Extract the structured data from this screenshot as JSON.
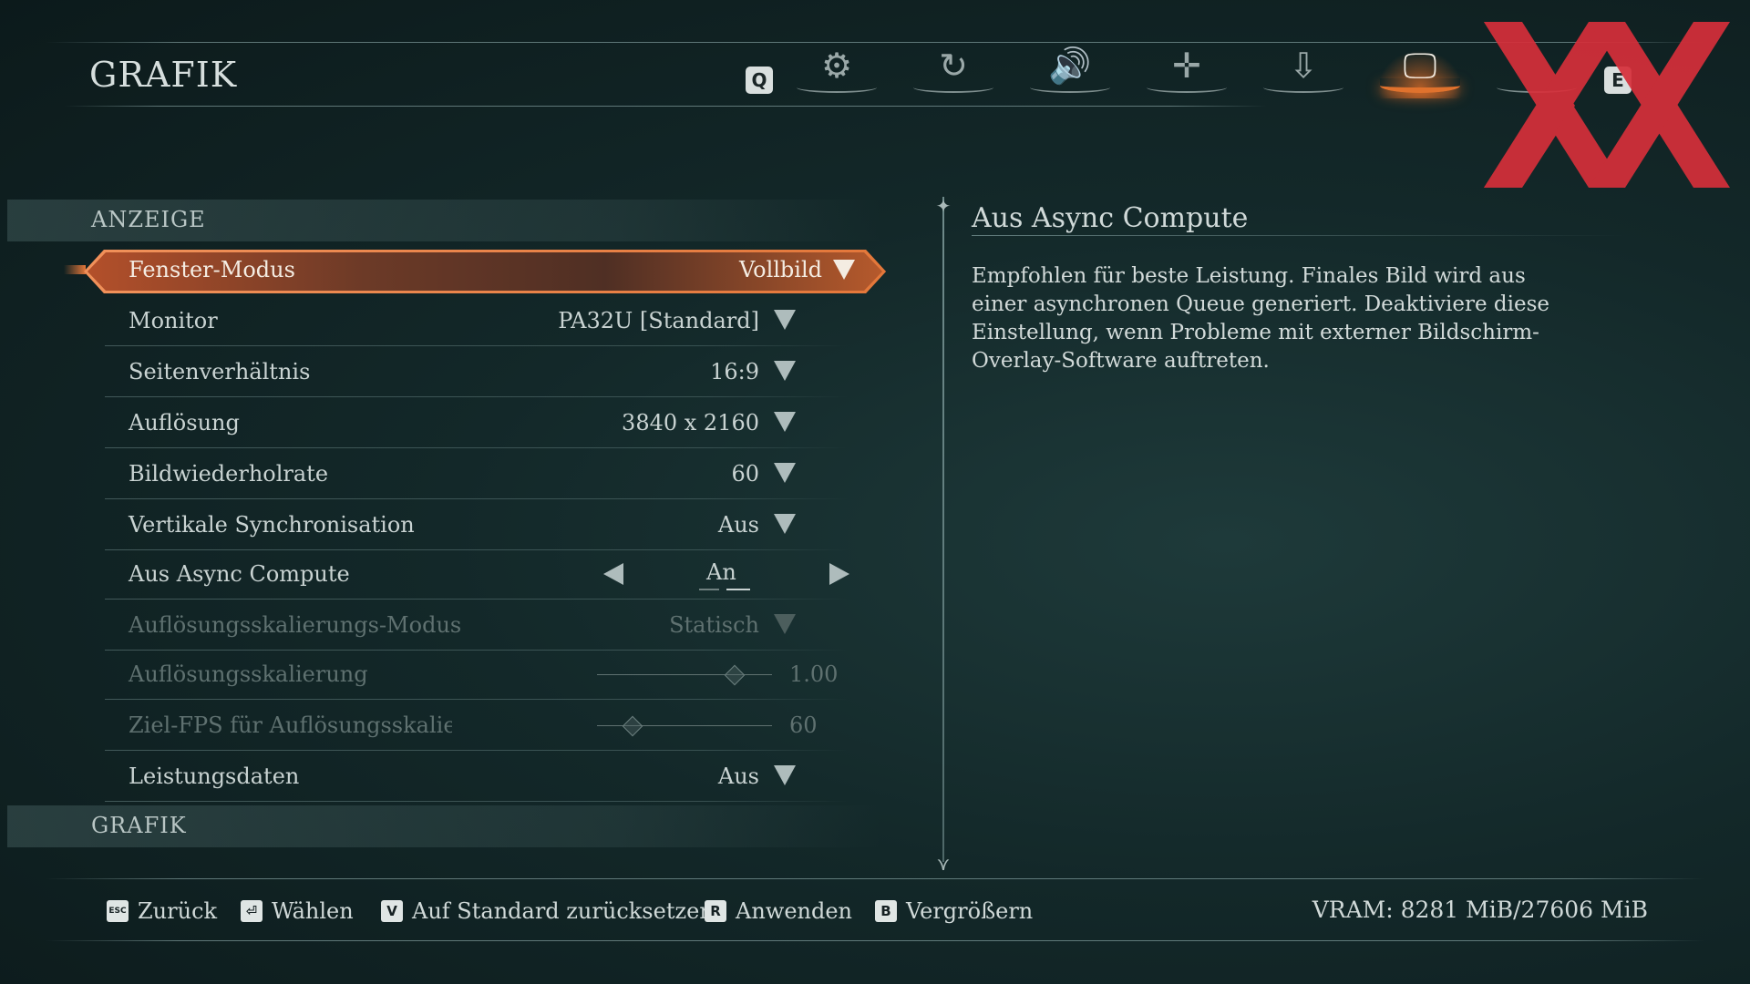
{
  "header": {
    "title": "GRAFIK",
    "key_left": "Q",
    "key_right": "E",
    "tabs": [
      {
        "icon": "gear-icon",
        "glyph": "⚙",
        "active": false
      },
      {
        "icon": "spiral-icon",
        "glyph": "↻",
        "active": false
      },
      {
        "icon": "speaker-icon",
        "glyph": "🔊",
        "active": false
      },
      {
        "icon": "dpad-icon",
        "glyph": "✛",
        "active": false
      },
      {
        "icon": "joystick-icon",
        "glyph": "⇩",
        "active": false
      },
      {
        "icon": "monitor-icon",
        "glyph": "🖵",
        "active": true
      },
      {
        "icon": "extra-tab-icon",
        "glyph": "",
        "active": false
      }
    ]
  },
  "watermark": {
    "color": "#d62f3a"
  },
  "sections": {
    "display": "ANZEIGE",
    "graphics": "GRAFIK"
  },
  "settings": [
    {
      "label": "Fenster-Modus",
      "value": "Vollbild",
      "type": "dropdown",
      "selected": true
    },
    {
      "label": "Monitor",
      "value": "PA32U [Standard]",
      "type": "dropdown"
    },
    {
      "label": "Seitenverhältnis",
      "value": "16:9",
      "type": "dropdown"
    },
    {
      "label": "Auflösung",
      "value": "3840 x 2160",
      "type": "dropdown"
    },
    {
      "label": "Bildwiederholrate",
      "value": "60",
      "type": "dropdown"
    },
    {
      "label": "Vertikale Synchronisation",
      "value": "Aus",
      "type": "dropdown"
    },
    {
      "label": "Aus Async Compute",
      "value": "An",
      "type": "stepper"
    },
    {
      "label": "Auflösungsskalierungs-Modus",
      "value": "Statisch",
      "type": "dropdown",
      "disabled": true
    },
    {
      "label": "Auflösungsskalierung",
      "value": "1.00",
      "type": "slider",
      "disabled": true,
      "level": 0.78
    },
    {
      "label": "Ziel-FPS für Auflösungsskalieru",
      "value": "60",
      "type": "slider",
      "disabled": true,
      "level": 0.2
    },
    {
      "label": "Leistungsdaten",
      "value": "Aus",
      "type": "dropdown"
    }
  ],
  "description": {
    "title": "Aus Async Compute",
    "text": "Empfohlen für beste Leistung. Finales Bild wird aus einer asynchronen Queue generiert. Deaktiviere diese Einstellung, wenn Probleme mit externer Bildschirm-Overlay-Software auftreten."
  },
  "footer": {
    "back": {
      "key": "ESC",
      "label": "Zurück"
    },
    "select": {
      "key": "⏎",
      "label": "Wählen"
    },
    "reset": {
      "key": "V",
      "label": "Auf Standard zurücksetzen"
    },
    "apply": {
      "key": "R",
      "label": "Anwenden"
    },
    "zoom": {
      "key": "B",
      "label": "Vergrößern"
    },
    "vram": "VRAM: 8281 MiB/27606 MiB"
  }
}
